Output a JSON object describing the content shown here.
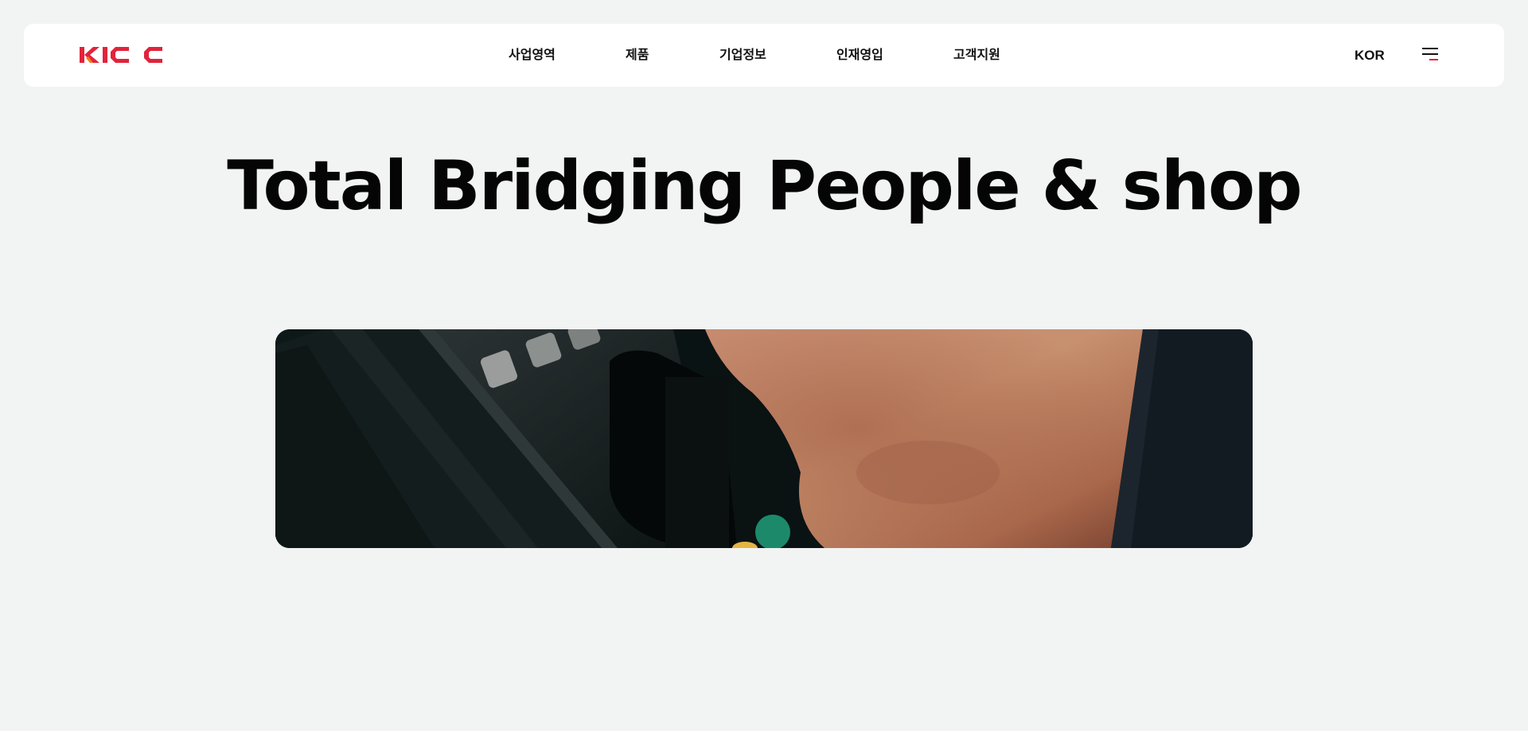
{
  "brand": {
    "logo_text": "KICC",
    "accent_color": "#e2233b",
    "accent_orange": "#f47a20"
  },
  "nav": {
    "items": [
      {
        "label": "사업영역"
      },
      {
        "label": "제품"
      },
      {
        "label": "기업정보"
      },
      {
        "label": "인재영입"
      },
      {
        "label": "고객지원"
      }
    ]
  },
  "header": {
    "language": "KOR",
    "menu_icon": "hamburger-menu-icon"
  },
  "hero": {
    "title": "Total Bridging People & shop",
    "image_subject": "hand-inserting-card-into-payment-terminal"
  }
}
